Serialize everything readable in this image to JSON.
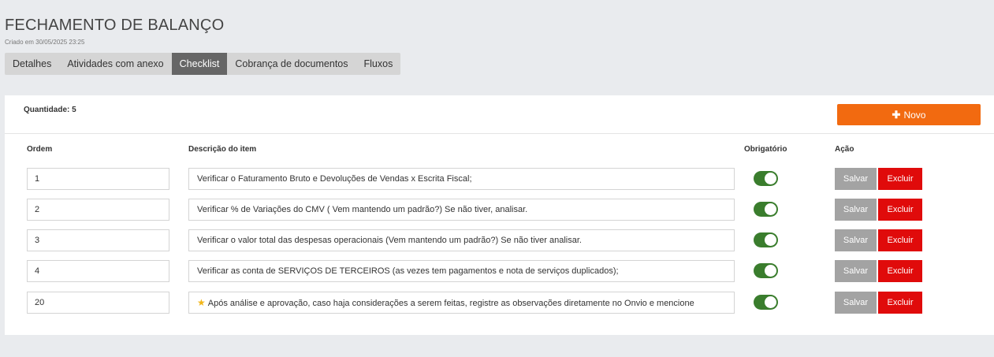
{
  "header": {
    "title": "FECHAMENTO DE BALANÇO",
    "created": "Criado em 30/05/2025 23:25"
  },
  "tabs": [
    {
      "label": "Detalhes",
      "active": false
    },
    {
      "label": "Atividades com anexo",
      "active": false
    },
    {
      "label": "Checklist",
      "active": true
    },
    {
      "label": "Cobrança de documentos",
      "active": false
    },
    {
      "label": "Fluxos",
      "active": false
    }
  ],
  "checklist": {
    "quantity_label": "Quantidade: 5",
    "new_button_label": "Novo",
    "columns": {
      "ordem": "Ordem",
      "descricao": "Descrição do item",
      "obrigatorio": "Obrigatório",
      "acao": "Ação"
    },
    "items": [
      {
        "ordem": "1",
        "descricao": "Verificar o Faturamento Bruto e Devoluções de Vendas x Escrita Fiscal;",
        "obrigatorio": true,
        "star": false
      },
      {
        "ordem": "2",
        "descricao": "Verificar % de Variações do CMV  ( Vem mantendo um padrão?) Se não tiver, analisar.",
        "obrigatorio": true,
        "star": false
      },
      {
        "ordem": "3",
        "descricao": "Verificar o valor total das despesas operacionais  (Vem mantendo um padrão?) Se não tiver analisar.",
        "obrigatorio": true,
        "star": false
      },
      {
        "ordem": "4",
        "descricao": "Verificar as conta de SERVIÇOS DE TERCEIROS (as vezes tem pagamentos e nota de serviços duplicados);",
        "obrigatorio": true,
        "star": false
      },
      {
        "ordem": "20",
        "descricao": "Após análise e aprovação, caso haja considerações a serem feitas, registre as observações diretamente no Onvio e mencione",
        "obrigatorio": true,
        "star": true
      }
    ],
    "save_label": "Salvar",
    "delete_label": "Excluir"
  },
  "colors": {
    "accent": "#f26a10",
    "active_tab": "#666666",
    "toggle_on": "#3a7d2d",
    "delete": "#e00b0b",
    "save": "#a3a3a3"
  }
}
